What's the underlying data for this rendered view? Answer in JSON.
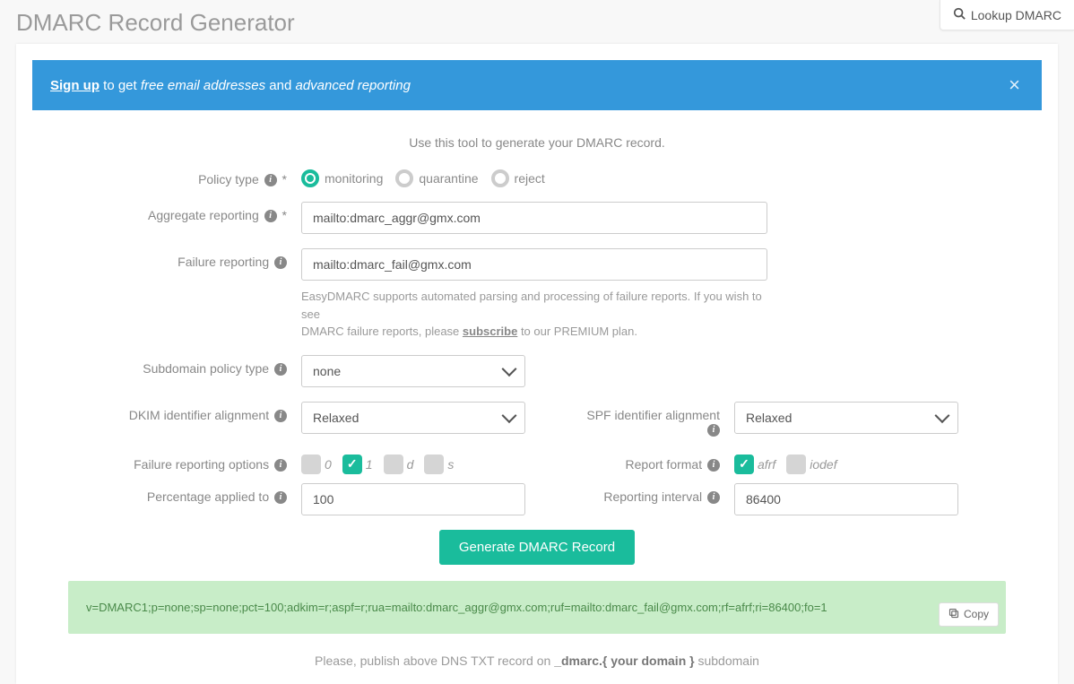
{
  "header": {
    "title": "DMARC Record Generator",
    "lookup_button": "Lookup DMARC"
  },
  "banner": {
    "signup": "Sign up",
    "middle1": " to get ",
    "em1": "free email addresses",
    "middle2": " and ",
    "em2": "advanced reporting"
  },
  "intro": "Use this tool to generate your DMARC record.",
  "labels": {
    "policy_type": "Policy type",
    "aggregate_reporting": "Aggregate reporting",
    "failure_reporting": "Failure reporting",
    "subdomain_policy": "Subdomain policy type",
    "dkim_alignment": "DKIM identifier alignment",
    "spf_alignment": "SPF identifier alignment",
    "failure_options": "Failure reporting options",
    "report_format": "Report format",
    "percentage": "Percentage applied to",
    "reporting_interval": "Reporting interval"
  },
  "policy": {
    "options": {
      "monitoring": "monitoring",
      "quarantine": "quarantine",
      "reject": "reject"
    },
    "selected": "monitoring"
  },
  "inputs": {
    "aggregate": "mailto:dmarc_aggr@gmx.com",
    "failure": "mailto:dmarc_fail@gmx.com",
    "percentage": "100",
    "interval": "86400"
  },
  "failure_help": {
    "line1": "EasyDMARC supports automated parsing and processing of failure reports. If you wish to see",
    "line2a": "DMARC failure reports, please ",
    "subscribe": "subscribe",
    "line2b": " to our PREMIUM plan."
  },
  "selects": {
    "subdomain": "none",
    "dkim": "Relaxed",
    "spf": "Relaxed"
  },
  "failure_opts": {
    "o0": "0",
    "o1": "1",
    "od": "d",
    "os": "s",
    "checked": [
      "1"
    ]
  },
  "report_fmt": {
    "afrf": "afrf",
    "iodef": "iodef",
    "checked": [
      "afrf"
    ]
  },
  "buttons": {
    "generate": "Generate DMARC Record",
    "copy": "Copy"
  },
  "result": "v=DMARC1;p=none;sp=none;pct=100;adkim=r;aspf=r;rua=mailto:dmarc_aggr@gmx.com;ruf=mailto:dmarc_fail@gmx.com;rf=afrf;ri=86400;fo=1",
  "publish": {
    "pre": "Please, publish above DNS TXT record on ",
    "bold": "_dmarc.{ your domain }",
    "post": " subdomain"
  }
}
